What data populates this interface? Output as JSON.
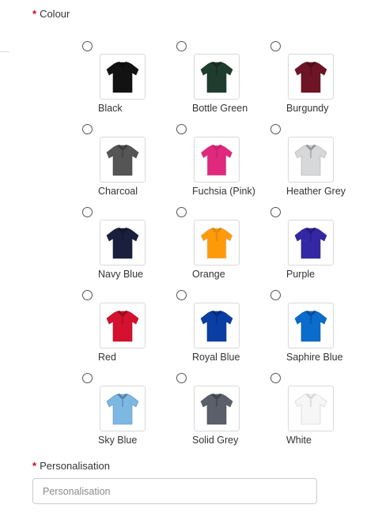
{
  "colour_field": {
    "required_marker": "*",
    "label": "Colour",
    "options": [
      {
        "name": "Black",
        "icon": "polo-shirt-icon",
        "color": "#121212"
      },
      {
        "name": "Bottle Green",
        "icon": "polo-shirt-icon",
        "color": "#1f3d2e"
      },
      {
        "name": "Burgundy",
        "icon": "polo-shirt-icon",
        "color": "#6e1427"
      },
      {
        "name": "Charcoal",
        "icon": "polo-shirt-icon",
        "color": "#555555"
      },
      {
        "name": "Fuchsia (Pink)",
        "icon": "polo-shirt-icon",
        "color": "#e0287d"
      },
      {
        "name": "Heather Grey",
        "icon": "polo-shirt-icon",
        "color": "#d7d8da"
      },
      {
        "name": "Navy Blue",
        "icon": "polo-shirt-icon",
        "color": "#1a1f3d"
      },
      {
        "name": "Orange",
        "icon": "polo-shirt-icon",
        "color": "#ff9a0a"
      },
      {
        "name": "Purple",
        "icon": "polo-shirt-icon",
        "color": "#3427a3"
      },
      {
        "name": "Red",
        "icon": "polo-shirt-icon",
        "color": "#d4112e"
      },
      {
        "name": "Royal Blue",
        "icon": "polo-shirt-icon",
        "color": "#0a3ea3"
      },
      {
        "name": "Saphire Blue",
        "icon": "polo-shirt-icon",
        "color": "#0a6ccc"
      },
      {
        "name": "Sky Blue",
        "icon": "polo-shirt-icon",
        "color": "#7db8e3"
      },
      {
        "name": "Solid Grey",
        "icon": "polo-shirt-icon",
        "color": "#5b5f6a"
      },
      {
        "name": "White",
        "icon": "polo-shirt-icon",
        "color": "#f6f6f6"
      }
    ]
  },
  "personalisation_field": {
    "required_marker": "*",
    "label": "Personalisation",
    "placeholder": "Personalisation",
    "value": ""
  },
  "colors": {
    "required_marker": "#d0021b",
    "input_border": "#cccccc",
    "swatch_border": "#d9d9d9"
  }
}
